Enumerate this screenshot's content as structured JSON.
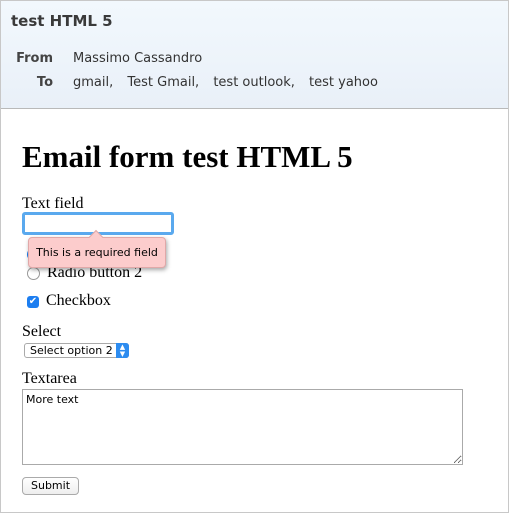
{
  "header": {
    "subject": "test HTML 5",
    "from_label": "From",
    "from_value": "Massimo Cassandro",
    "to_label": "To",
    "recipients": [
      "gmail,",
      "Test Gmail,",
      "test outlook,",
      "test yahoo"
    ]
  },
  "form": {
    "title": "Email form test HTML 5",
    "text_field_label": "Text field",
    "text_field_value": "",
    "validation_message": "This is a required field",
    "radio1_selected": true,
    "radio2_label": "Radio button 2",
    "radio2_selected": false,
    "checkbox_label": "Checkbox",
    "checkbox_checked": true,
    "select_label": "Select",
    "select_value": "Select option 2",
    "textarea_label": "Textarea",
    "textarea_value": "More text",
    "submit_label": "Submit"
  },
  "colors": {
    "accent": "#1d7ef0",
    "tooltip_bg": "#fccccc",
    "focus_ring": "#5aa9ee"
  }
}
